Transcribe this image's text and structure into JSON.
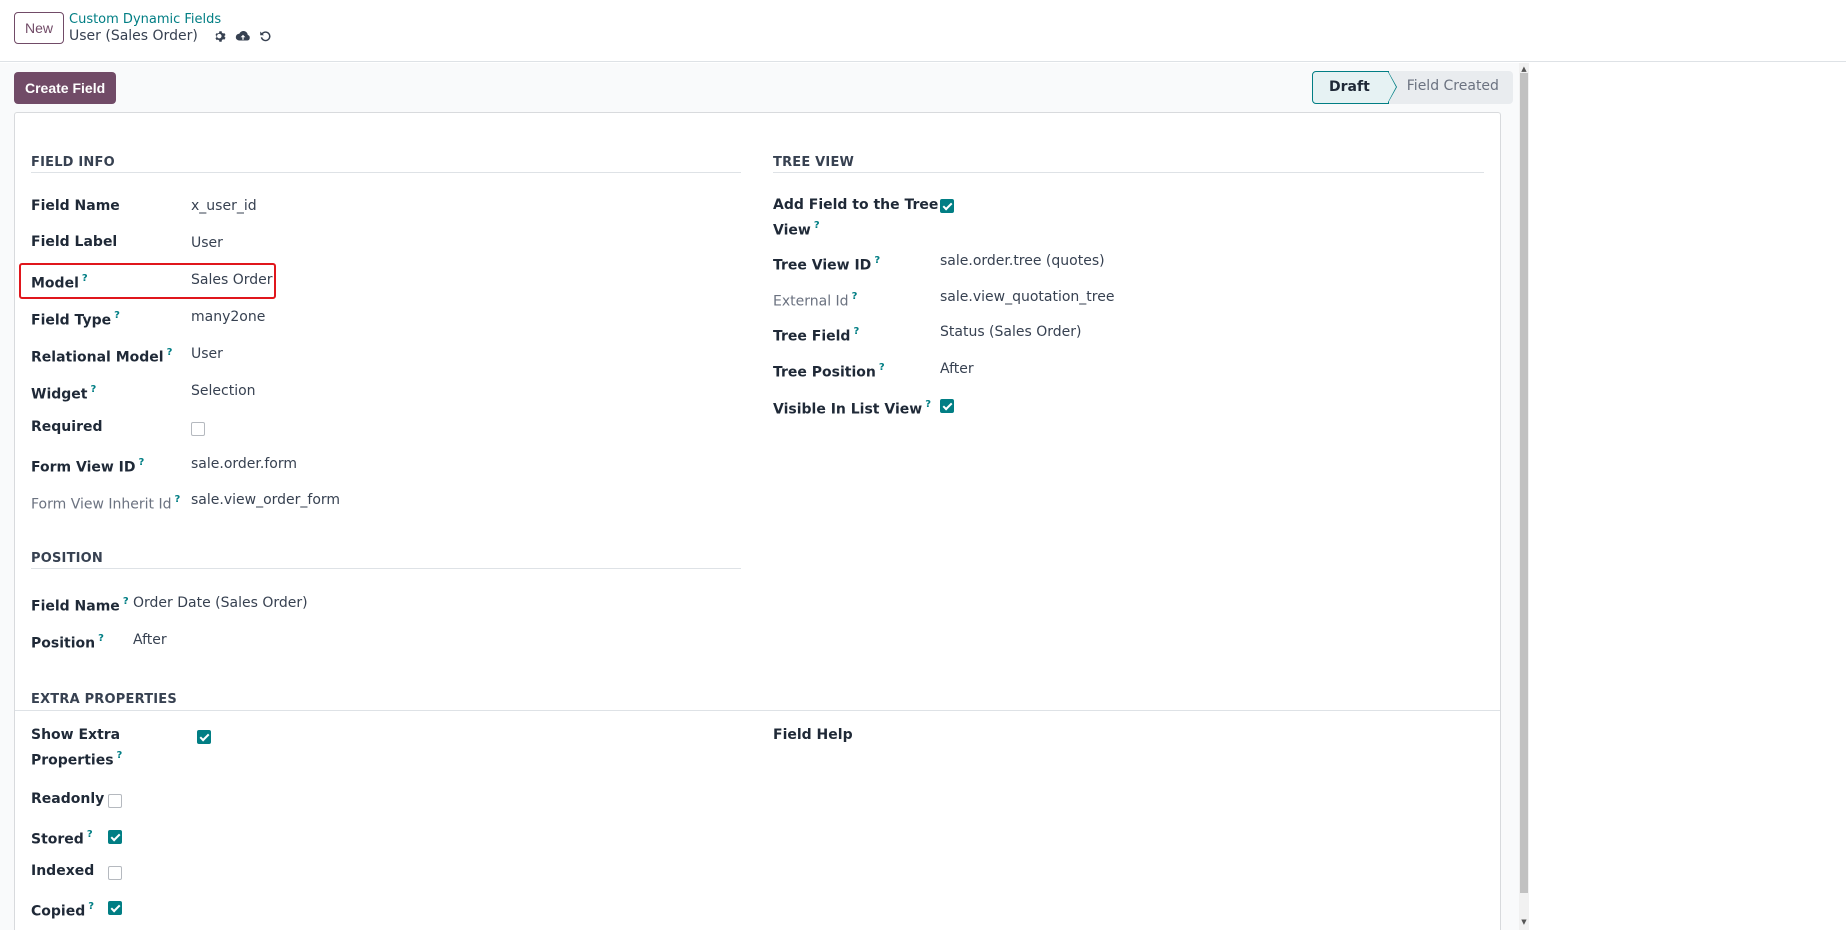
{
  "control_panel": {
    "new_label": "New",
    "breadcrumb_parent": "Custom Dynamic Fields",
    "record_title": "User (Sales Order)"
  },
  "actions": {
    "create_field_label": "Create Field"
  },
  "statusbar": {
    "stages": [
      "Draft",
      "Field Created"
    ],
    "active": "Draft"
  },
  "field_info": {
    "title": "FIELD INFO",
    "rows": [
      {
        "label": "Field Name",
        "value": "x_user_id"
      },
      {
        "label": "Field Label",
        "value": "User"
      },
      {
        "label": "Model",
        "value": "Sales Order",
        "help": "?"
      },
      {
        "label": "Field Type",
        "value": "many2one",
        "help": "?"
      },
      {
        "label": "Relational Model",
        "value": "User",
        "help": "?"
      },
      {
        "label": "Widget",
        "value": "Selection",
        "help": "?"
      },
      {
        "label": "Required",
        "value": ""
      },
      {
        "label": "Form View ID",
        "value": "sale.order.form",
        "help": "?"
      },
      {
        "label": "Form View Inherit Id",
        "value": "sale.view_order_form",
        "help": "?"
      }
    ],
    "required_checked": false
  },
  "tree_view": {
    "title": "TREE VIEW",
    "add_field_label_line1": "Add Field to the Tree",
    "add_field_label_line2": "View",
    "add_field_checked": true,
    "rows": [
      {
        "label": "Tree View ID",
        "value": "sale.order.tree (quotes)",
        "help": "?"
      },
      {
        "label": "External Id",
        "value": "sale.view_quotation_tree",
        "help": "?"
      },
      {
        "label": "Tree Field",
        "value": "Status (Sales Order)",
        "help": "?"
      },
      {
        "label": "Tree Position",
        "value": "After",
        "help": "?"
      },
      {
        "label": "Visible In List View",
        "value": "",
        "help": "?"
      }
    ],
    "visible_in_list_checked": true
  },
  "position": {
    "title": "POSITION",
    "rows": [
      {
        "label": "Field Name",
        "value": "Order Date (Sales Order)",
        "help": "?"
      },
      {
        "label": "Position",
        "value": "After",
        "help": "?"
      }
    ]
  },
  "extra_properties": {
    "title": "EXTRA PROPERTIES",
    "show_extra_line1": "Show Extra",
    "show_extra_line2": "Properties",
    "show_extra_checked": true,
    "field_help_label": "Field Help",
    "flags": [
      {
        "label": "Readonly",
        "checked": false
      },
      {
        "label": "Stored",
        "checked": true,
        "help": "?"
      },
      {
        "label": "Indexed",
        "checked": false
      },
      {
        "label": "Copied",
        "checked": true,
        "help": "?"
      }
    ]
  },
  "colors": {
    "brand": "#714B67",
    "accent": "#017e84",
    "highlight": "#e0161c"
  },
  "icons": [
    "gear-icon",
    "cloud-upload-icon",
    "discard-icon"
  ]
}
